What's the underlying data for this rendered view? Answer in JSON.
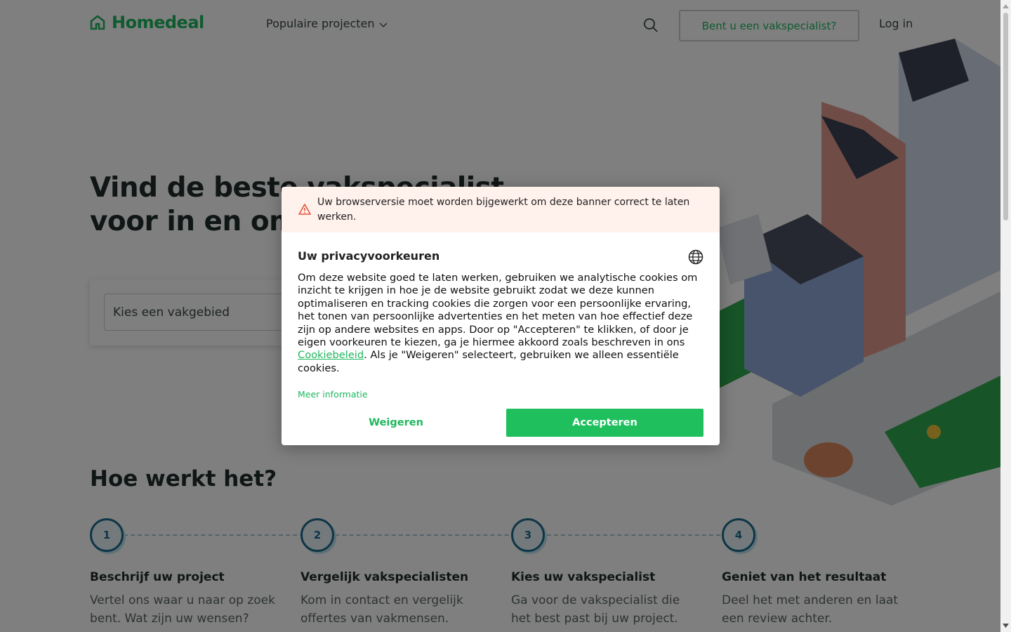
{
  "header": {
    "logo_text": "Homedeal",
    "nav_projects_label": "Populaire projecten",
    "pro_button_label": "Bent u een vakspecialist?",
    "login_label": "Log in"
  },
  "hero": {
    "title_line1": "Vind de beste vakspecialist",
    "title_line2": "voor in en om uw huis",
    "search_placeholder": "Kies een vakgebied"
  },
  "how": {
    "title": "Hoe werkt het?",
    "steps": [
      {
        "number": "1",
        "title": "Beschrijf uw project",
        "desc": "Vertel ons waar u naar op zoek bent. Wat zijn uw wensen?"
      },
      {
        "number": "2",
        "title": "Vergelijk vakspecialisten",
        "desc": "Kom in contact en vergelijk offertes van vakmensen."
      },
      {
        "number": "3",
        "title": "Kies uw vakspecialist",
        "desc": "Ga voor de vakspecialist die het best past bij uw project."
      },
      {
        "number": "4",
        "title": "Geniet van het resultaat",
        "desc": "Deel het met anderen en laat een review achter."
      }
    ]
  },
  "cookie_dialog": {
    "warning_text": "Uw browserversie moet worden bijgewerkt om deze banner correct te laten werken.",
    "title": "Uw privacyvoorkeuren",
    "body_part1": "Om deze website goed te laten werken, gebruiken we analytische cookies om inzicht te krijgen in hoe je de website gebruikt zodat we deze kunnen optimaliseren en tracking cookies die zorgen voor een persoonlijke ervaring, het tonen van persoonlijke advertenties en het meten van hoe effectief deze zijn op andere websites en apps. Door op \"Accepteren\" te klikken, of door je eigen voorkeuren te kiezen, ga je hiermee akkoord zoals beschreven in ons ",
    "body_link": "Cookiebeleid",
    "body_part2": ". Als je \"Weigeren\" selecteert, gebruiken we alleen essentiële cookies.",
    "more_info_label": "Meer informatie",
    "refuse_label": "Weigeren",
    "accept_label": "Accepteren"
  },
  "colors": {
    "brand_green": "#1fb75e",
    "accept_green": "#1fbf5e",
    "step_blue": "#1f6d8f",
    "warning_bg": "#fff1ec",
    "warning_icon": "#e5533d"
  }
}
